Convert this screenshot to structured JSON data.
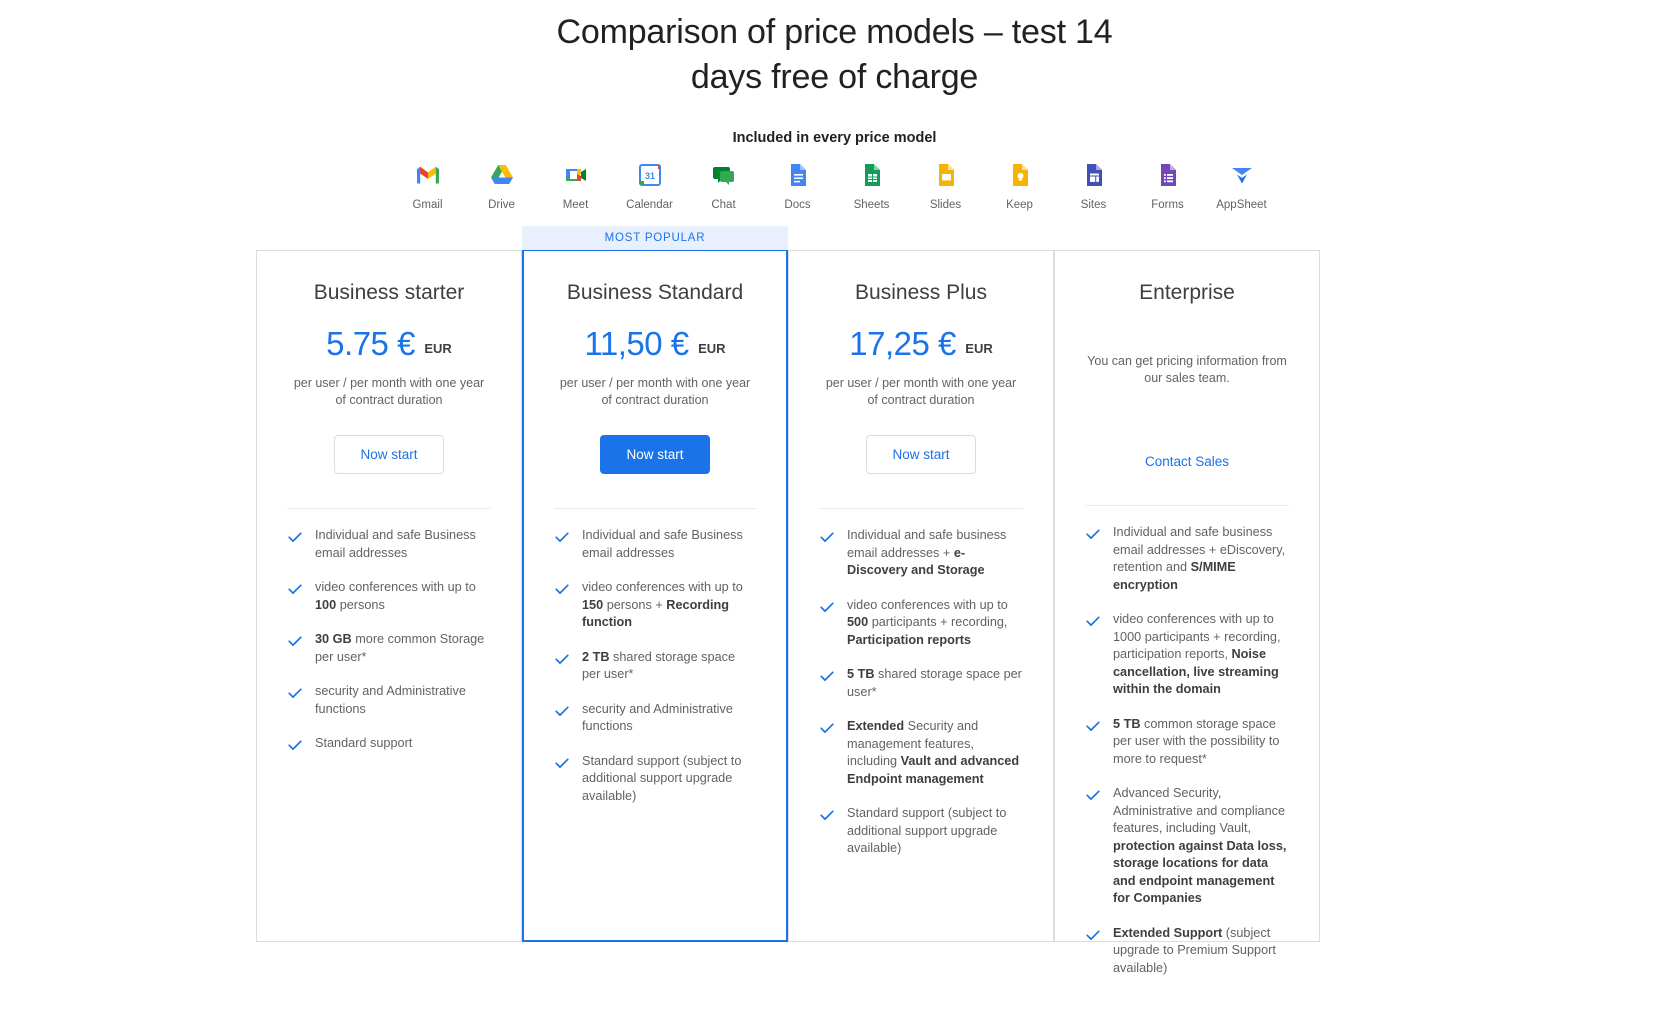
{
  "header": {
    "title": "Comparison of price models – test 14 days free of charge",
    "included_label": "Included in every price model"
  },
  "apps": [
    {
      "name": "Gmail",
      "icon": "gmail-icon"
    },
    {
      "name": "Drive",
      "icon": "drive-icon"
    },
    {
      "name": "Meet",
      "icon": "meet-icon"
    },
    {
      "name": "Calendar",
      "icon": "calendar-icon"
    },
    {
      "name": "Chat",
      "icon": "chat-icon"
    },
    {
      "name": "Docs",
      "icon": "docs-icon"
    },
    {
      "name": "Sheets",
      "icon": "sheets-icon"
    },
    {
      "name": "Slides",
      "icon": "slides-icon"
    },
    {
      "name": "Keep",
      "icon": "keep-icon"
    },
    {
      "name": "Sites",
      "icon": "sites-icon"
    },
    {
      "name": "Forms",
      "icon": "forms-icon"
    },
    {
      "name": "AppSheet",
      "icon": "appsheet-icon"
    }
  ],
  "colors": {
    "accent": "#1a73e8",
    "ribbon_bg": "#e8f0fe",
    "card_border": "#dadce0",
    "text_primary": "#3c4043",
    "text_secondary": "#5f6368"
  },
  "plans": [
    {
      "name": "Business starter",
      "price": "5.75 €",
      "currency": "EUR",
      "price_note": "per user / per month with one year of contract duration",
      "cta_label": "Now start",
      "cta_style": "outline",
      "ribbon": "",
      "features": [
        [
          {
            "t": "Individual and safe Business email addresses",
            "b": false
          }
        ],
        [
          {
            "t": "video conferences with up to ",
            "b": false
          },
          {
            "t": "100",
            "b": true
          },
          {
            "t": " persons",
            "b": false
          }
        ],
        [
          {
            "t": "30 GB",
            "b": true
          },
          {
            "t": " more common Storage per user*",
            "b": false
          }
        ],
        [
          {
            "t": "security and Administrative functions",
            "b": false
          }
        ],
        [
          {
            "t": "Standard support",
            "b": false
          }
        ]
      ]
    },
    {
      "name": "Business Standard",
      "price": "11,50 €",
      "currency": "EUR",
      "price_note": "per user / per month with one year of contract duration",
      "cta_label": "Now start",
      "cta_style": "solid",
      "ribbon": "MOST POPULAR",
      "features": [
        [
          {
            "t": "Individual and safe Business email addresses",
            "b": false
          }
        ],
        [
          {
            "t": "video conferences with up to ",
            "b": false
          },
          {
            "t": "150",
            "b": true
          },
          {
            "t": " persons + ",
            "b": false
          },
          {
            "t": "Recording function",
            "b": true
          }
        ],
        [
          {
            "t": "2 TB",
            "b": true
          },
          {
            "t": " shared storage space per user*",
            "b": false
          }
        ],
        [
          {
            "t": "security and Administrative functions",
            "b": false
          }
        ],
        [
          {
            "t": "Standard support (subject to additional support upgrade available)",
            "b": false
          }
        ]
      ]
    },
    {
      "name": "Business Plus",
      "price": "17,25 €",
      "currency": "EUR",
      "price_note": "per user / per month with one year of contract duration",
      "cta_label": "Now start",
      "cta_style": "outline",
      "ribbon": "",
      "features": [
        [
          {
            "t": "Individual and safe business email addresses + ",
            "b": false
          },
          {
            "t": "e-Discovery and Storage",
            "b": true
          }
        ],
        [
          {
            "t": "video conferences with up to ",
            "b": false
          },
          {
            "t": "500",
            "b": true
          },
          {
            "t": " participants + recording, ",
            "b": false
          },
          {
            "t": "Participation reports",
            "b": true
          }
        ],
        [
          {
            "t": "5 TB",
            "b": true
          },
          {
            "t": " shared storage space per user*",
            "b": false
          }
        ],
        [
          {
            "t": "Extended",
            "b": true
          },
          {
            "t": " Security and management features, including ",
            "b": false
          },
          {
            "t": "Vault and advanced Endpoint management",
            "b": true
          }
        ],
        [
          {
            "t": "Standard support (subject to additional support upgrade available)",
            "b": false
          }
        ]
      ]
    },
    {
      "name": "Enterprise",
      "price": "",
      "currency": "",
      "price_note": "You can get pricing information from our sales team.",
      "cta_label": "Contact Sales",
      "cta_style": "link",
      "ribbon": "",
      "features": [
        [
          {
            "t": "Individual and safe business email addresses + eDiscovery, retention and ",
            "b": false
          },
          {
            "t": "S/MIME encryption",
            "b": true
          }
        ],
        [
          {
            "t": "video conferences with up to 1000 participants + recording, participation reports, ",
            "b": false
          },
          {
            "t": "Noise cancellation, live streaming within the domain",
            "b": true
          }
        ],
        [
          {
            "t": "5 TB",
            "b": true
          },
          {
            "t": " common storage space per user with the possibility to more to request*",
            "b": false
          }
        ],
        [
          {
            "t": "Advanced Security, Administrative and compliance features, including Vault, ",
            "b": false
          },
          {
            "t": "protection against Data loss, storage locations for data and endpoint management for Companies",
            "b": true
          }
        ],
        [
          {
            "t": "Extended Support",
            "b": true
          },
          {
            "t": " (subject upgrade to Premium Support available)",
            "b": false
          }
        ]
      ]
    }
  ]
}
